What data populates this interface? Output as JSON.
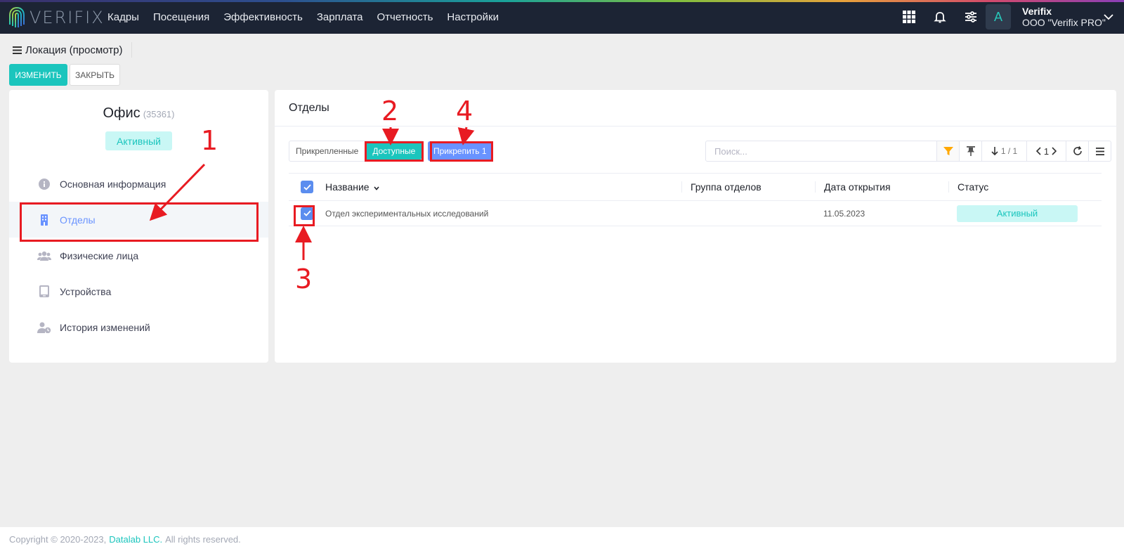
{
  "app": {
    "logo_text": "VERIFIX",
    "nav": [
      "Кадры",
      "Посещения",
      "Эффективность",
      "Зарплата",
      "Отчетность",
      "Настройки"
    ],
    "user_initial": "A",
    "user_name": "Verifix",
    "org_name": "ООО \"Verifix PRO\""
  },
  "page": {
    "title": "Локация (просмотр)",
    "edit_label": "ИЗМЕНИТЬ",
    "close_label": "ЗАКРЫТЬ"
  },
  "location": {
    "name": "Офис",
    "code": "(35361)",
    "status": "Активный"
  },
  "sidebar": {
    "items": [
      {
        "label": "Основная информация",
        "icon": "info-icon"
      },
      {
        "label": "Отделы",
        "icon": "building-icon",
        "active": true
      },
      {
        "label": "Физические лица",
        "icon": "users-icon"
      },
      {
        "label": "Устройства",
        "icon": "tablet-icon"
      },
      {
        "label": "История изменений",
        "icon": "user-history-icon"
      }
    ]
  },
  "departments": {
    "title": "Отделы",
    "tab_attached": "Прикрепленные",
    "tab_available": "Доступные",
    "attach_label": "Прикрепить 1",
    "search_placeholder": "Поиск...",
    "pager_count": "1 / 1",
    "page_number": "1",
    "columns": [
      "Название",
      "Группа отделов",
      "Дата открытия",
      "Статус"
    ],
    "rows": [
      {
        "name": "Отдел экспериментальных исследований",
        "group": "",
        "date": "11.05.2023",
        "status": "Активный",
        "checked": true
      }
    ]
  },
  "annotations": {
    "one": "1",
    "two": "2",
    "three": "3",
    "four": "4"
  },
  "footer": {
    "prefix": "Copyright © 2020-2023,",
    "company": "Datalab LLC.",
    "suffix": "All rights reserved."
  },
  "colors": {
    "accent": "#1bc5bd",
    "primary": "#6993ff",
    "nav_bg": "#1c2434",
    "annotation": "#e81b22"
  }
}
